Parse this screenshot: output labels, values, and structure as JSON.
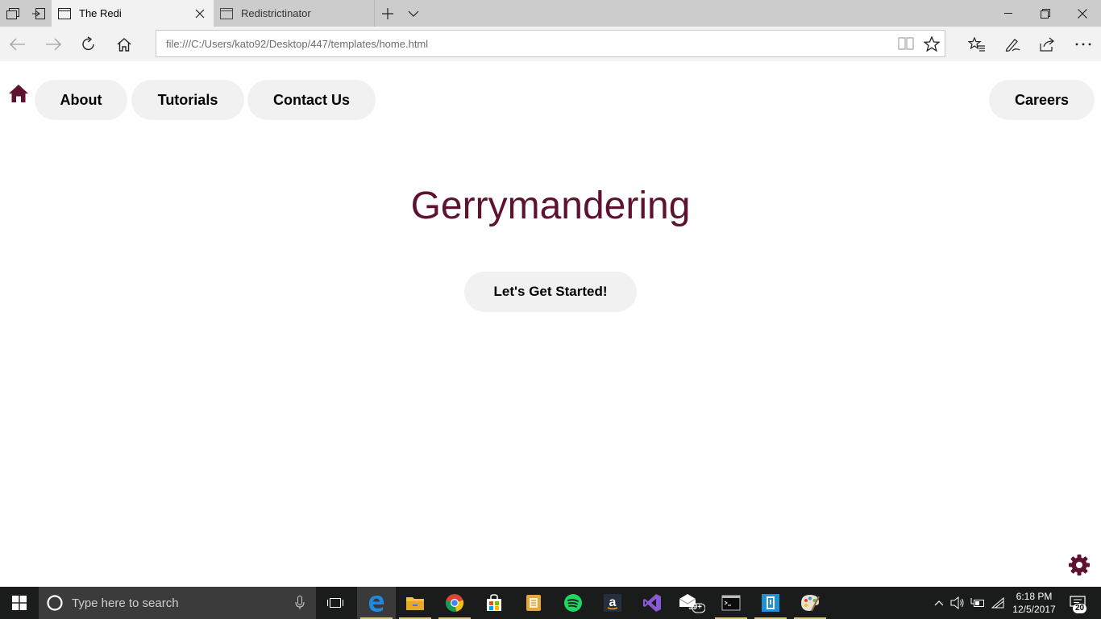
{
  "browser": {
    "tabs": [
      {
        "title": "The Redi",
        "active": true
      },
      {
        "title": "Redistrictinator",
        "active": false
      }
    ],
    "address": {
      "url": "file:///C:/Users/kato92/Desktop/447/templates/home.html"
    }
  },
  "page": {
    "nav": {
      "about": "About",
      "tutorials": "Tutorials",
      "contact": "Contact Us",
      "careers": "Careers"
    },
    "headline": "Gerrymandering",
    "cta": "Let's Get Started!"
  },
  "taskbar": {
    "search_placeholder": "Type here to search",
    "mail_badge": "99+",
    "time": "6:18 PM",
    "date": "12/5/2017",
    "notifications": "20"
  },
  "colors": {
    "accent": "#5e1230",
    "pill_bg": "#f1f1f1",
    "taskbar_bg": "#1a1c1c"
  },
  "icons": [
    "tabs-icon",
    "set-aside-icon",
    "tab-page-icon",
    "close-icon",
    "new-tab-icon",
    "chevron-down-icon",
    "minimize-icon",
    "restore-icon",
    "back-icon",
    "forward-icon",
    "refresh-icon",
    "home-icon",
    "reading-view-icon",
    "star-icon",
    "favorites-hub-icon",
    "pen-icon",
    "share-icon",
    "more-icon",
    "gear-icon",
    "windows-icon",
    "cortana-icon",
    "microphone-icon",
    "task-view-icon",
    "edge-icon",
    "file-explorer-icon",
    "chrome-icon",
    "store-icon",
    "office-icon",
    "spotify-icon",
    "amazon-icon",
    "visual-studio-icon",
    "mail-icon",
    "terminal-icon",
    "app-icon",
    "paint-icon",
    "chevron-up-icon",
    "volume-icon",
    "battery-icon",
    "wifi-icon",
    "notification-icon"
  ]
}
